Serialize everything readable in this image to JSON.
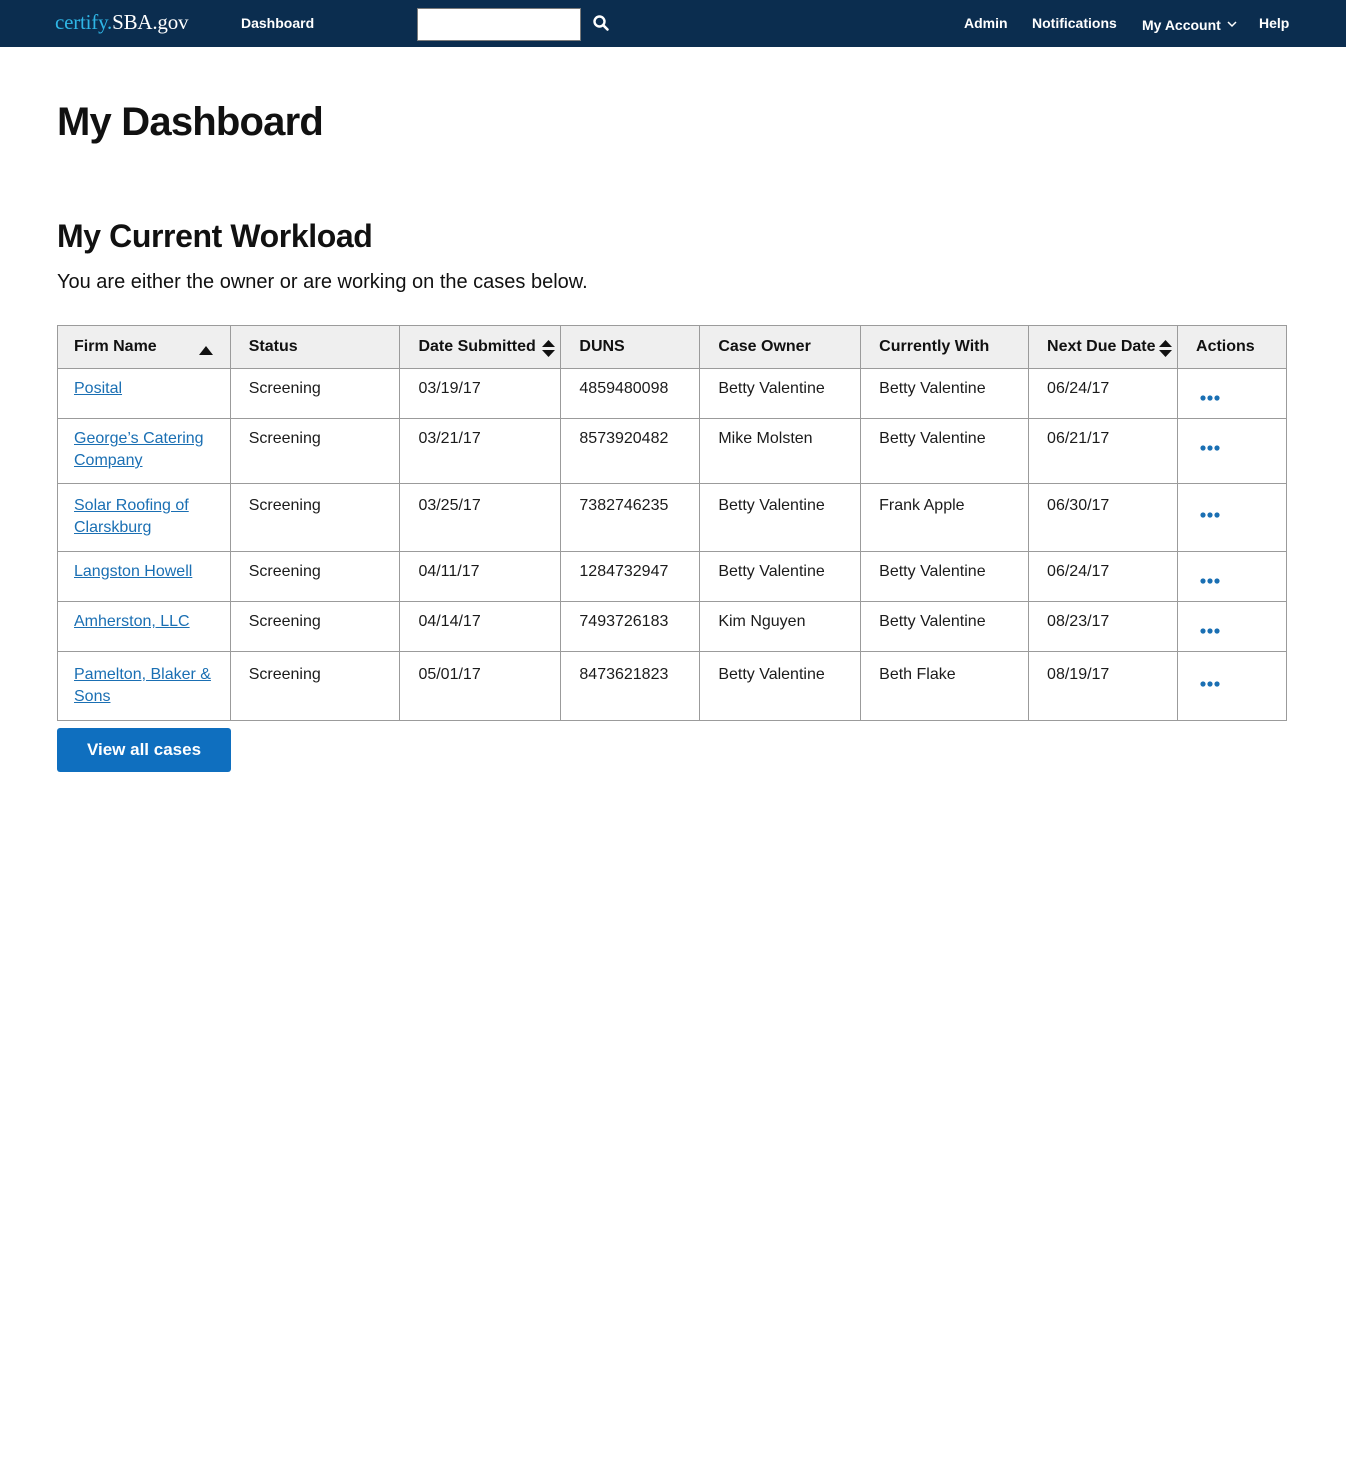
{
  "header": {
    "logo_part1": "certify.",
    "logo_part2": "SBA.gov",
    "dashboard_link": "Dashboard",
    "search_placeholder": "",
    "admin_link": "Admin",
    "notifications_link": "Notifications",
    "my_account_link": "My Account",
    "help_link": "Help"
  },
  "page": {
    "title": "My Dashboard",
    "section_title": "My Current Workload",
    "section_intro": "You are either the owner or are working on the cases below."
  },
  "table": {
    "columns": [
      "Firm Name",
      "Status",
      "Date Submitted",
      "DUNS",
      "Case Owner",
      "Currently With",
      "Next Due Date",
      "Actions"
    ],
    "rows": [
      {
        "firm": "Posital",
        "status": "Screening",
        "date_submitted": "03/19/17",
        "duns": "4859480098",
        "case_owner": "Betty Valentine",
        "currently_with": "Betty Valentine",
        "next_due": "06/24/17"
      },
      {
        "firm": "George’s Catering Company",
        "status": "Screening",
        "date_submitted": "03/21/17",
        "duns": "8573920482",
        "case_owner": "Mike Molsten",
        "currently_with": "Betty Valentine",
        "next_due": "06/21/17"
      },
      {
        "firm": "Solar Roofing of Clarskburg",
        "status": "Screening",
        "date_submitted": "03/25/17",
        "duns": "7382746235",
        "case_owner": "Betty Valentine",
        "currently_with": "Frank Apple",
        "next_due": "06/30/17"
      },
      {
        "firm": "Langston Howell",
        "status": "Screening",
        "date_submitted": "04/11/17",
        "duns": "1284732947",
        "case_owner": "Betty Valentine",
        "currently_with": "Betty Valentine",
        "next_due": "06/24/17"
      },
      {
        "firm": "Amherston, LLC",
        "status": "Screening",
        "date_submitted": "04/14/17",
        "duns": "7493726183",
        "case_owner": "Kim Nguyen",
        "currently_with": "Betty Valentine",
        "next_due": "08/23/17"
      },
      {
        "firm": "Pamelton, Blaker & Sons",
        "status": "Screening",
        "date_submitted": "05/01/17",
        "duns": "8473621823",
        "case_owner": "Betty Valentine",
        "currently_with": "Beth Flake",
        "next_due": "08/19/17"
      }
    ],
    "sort_column": "Firm Name",
    "sort_direction": "ascending"
  },
  "view_all_button": "View all cases",
  "colors": {
    "header_bg": "#0b2d4f",
    "logo_accent": "#2fb6e6",
    "link": "#1a6fb3",
    "primary_button": "#0f6fbf"
  },
  "icons": {
    "search": "search-icon",
    "chevron": "chevron-down-icon",
    "sort_asc": "sort-ascending-icon",
    "sort_both": "sort-icon",
    "actions": "more-actions-icon"
  }
}
